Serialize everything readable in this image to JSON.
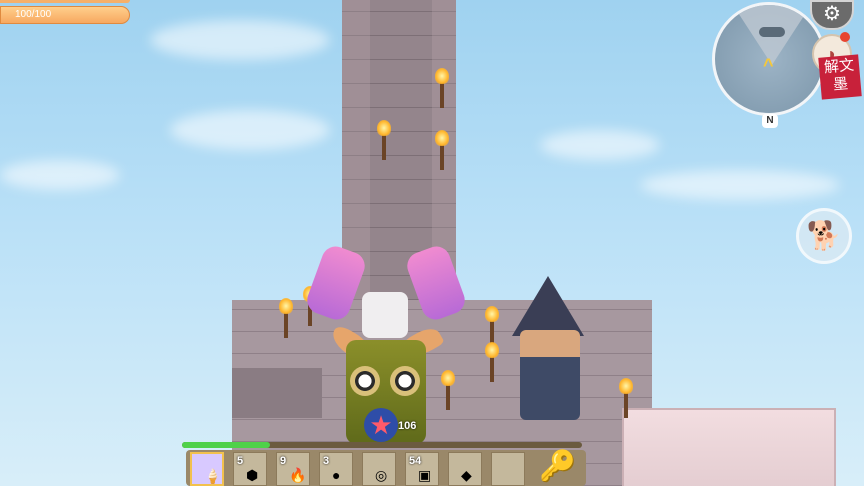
{
  "hud": {
    "health_text": "100/100",
    "health_fraction": 1.0,
    "xp_fraction": 0.22,
    "ammo_count": "106"
  },
  "minimap": {
    "compass_label": "N",
    "player_arrow_icon": "chevron-up-icon"
  },
  "buttons": {
    "settings_icon": "gear-icon",
    "backpack_icon": "backpack-icon",
    "pet_icon": "pet-dog-icon"
  },
  "seal_text": "解文墨",
  "hotbar": {
    "slots": [
      {
        "count": "",
        "icon": "ice-cream-icon",
        "selected": true
      },
      {
        "count": "5",
        "icon": "stone-icon"
      },
      {
        "count": "9",
        "icon": "torch-icon"
      },
      {
        "count": "3",
        "icon": "rock-icon"
      },
      {
        "count": "",
        "icon": "disc-icon"
      },
      {
        "count": "54",
        "icon": "crate-icon"
      },
      {
        "count": "",
        "icon": "crystal-icon"
      },
      {
        "count": "",
        "icon": "empty-slot"
      }
    ],
    "trailing_icon": "key-icon"
  },
  "colors": {
    "sky": "#b9e0f7",
    "hp_bar": "#f7a860",
    "xp_fill": "#4fd14a",
    "selected_slot": "#d8c9ff"
  }
}
